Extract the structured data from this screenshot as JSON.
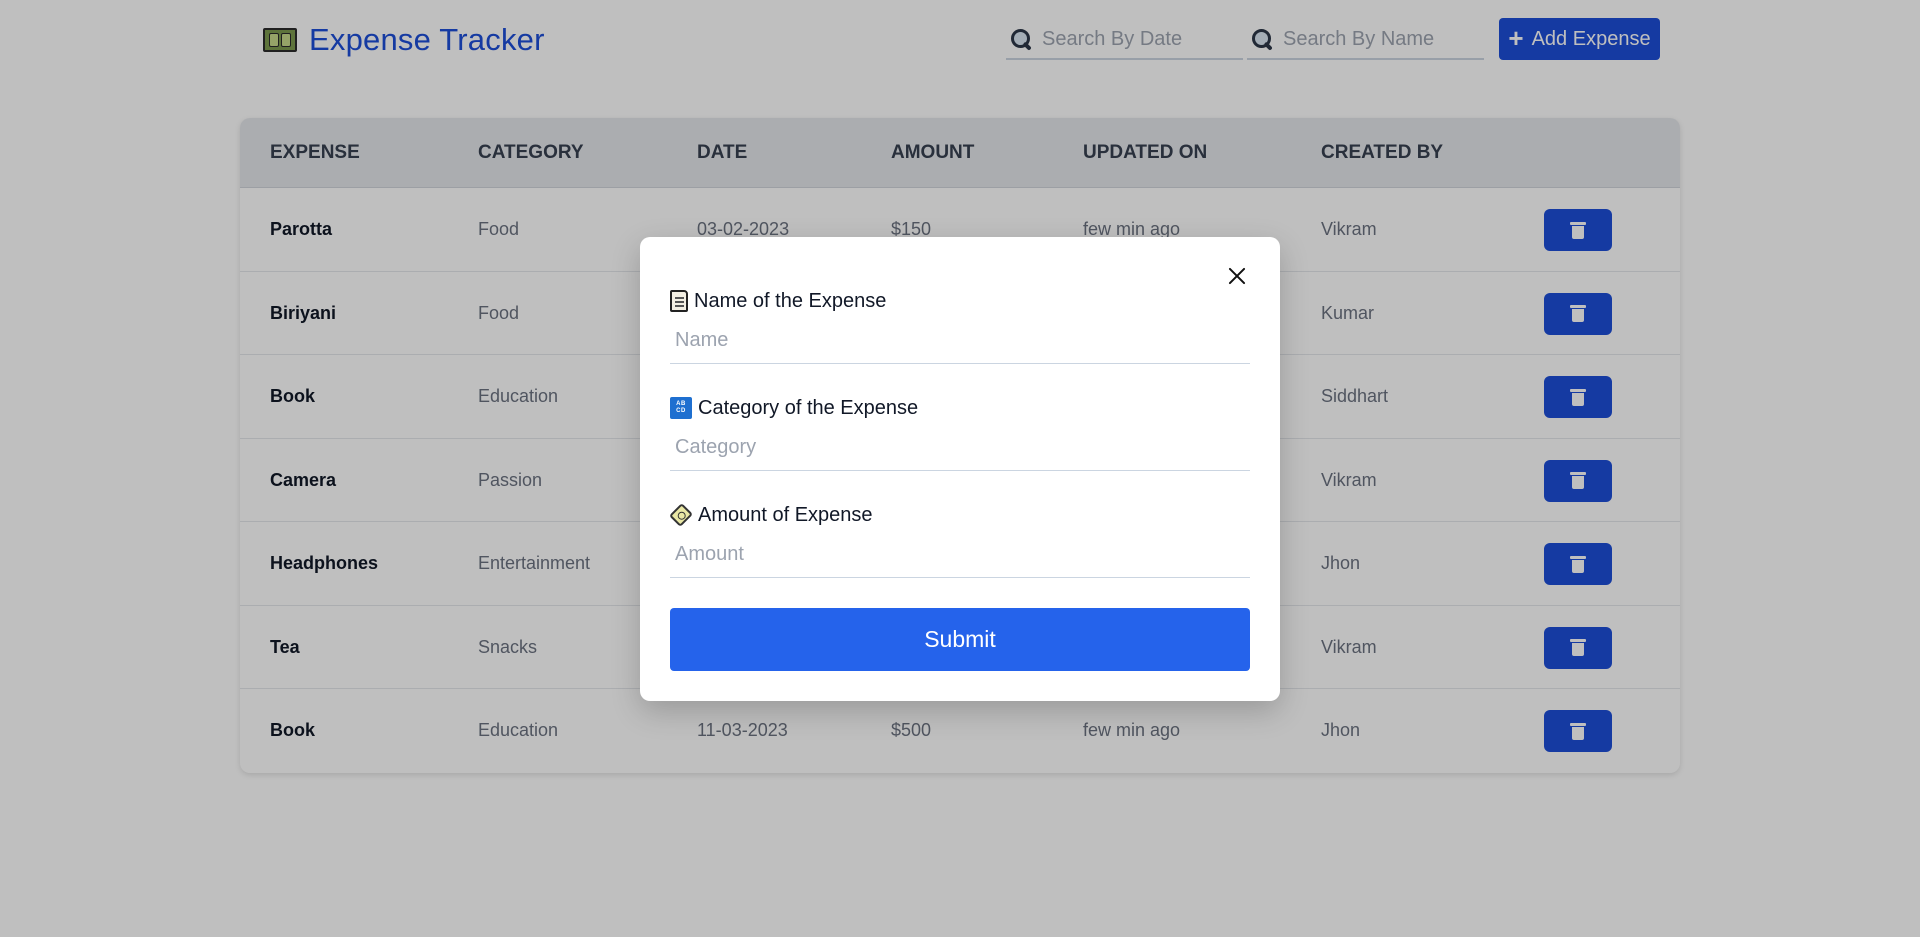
{
  "app": {
    "title": "Expense Tracker",
    "logo_icon": "money-bag-icon"
  },
  "header": {
    "search_date": {
      "placeholder": "Search By Date",
      "value": ""
    },
    "search_name": {
      "placeholder": "Search By Name",
      "value": ""
    },
    "add_button": {
      "label": "Add Expense",
      "icon": "plus-icon"
    }
  },
  "table": {
    "columns": [
      "EXPENSE",
      "CATEGORY",
      "DATE",
      "AMOUNT",
      "UPDATED ON",
      "CREATED BY"
    ],
    "rows": [
      {
        "expense": "Parotta",
        "category": "Food",
        "date": "03-02-2023",
        "amount": "$150",
        "updated": "few min ago",
        "created_by": "Vikram"
      },
      {
        "expense": "Biriyani",
        "category": "Food",
        "date": "",
        "amount": "",
        "updated": "",
        "created_by": "Kumar"
      },
      {
        "expense": "Book",
        "category": "Education",
        "date": "",
        "amount": "",
        "updated": "",
        "created_by": "Siddhart"
      },
      {
        "expense": "Camera",
        "category": "Passion",
        "date": "",
        "amount": "",
        "updated": "",
        "created_by": "Vikram"
      },
      {
        "expense": "Headphones",
        "category": "Entertainment",
        "date": "",
        "amount": "",
        "updated": "",
        "created_by": "Jhon"
      },
      {
        "expense": "Tea",
        "category": "Snacks",
        "date": "",
        "amount": "",
        "updated": "",
        "created_by": "Vikram"
      },
      {
        "expense": "Book",
        "category": "Education",
        "date": "11-03-2023",
        "amount": "$500",
        "updated": "few min ago",
        "created_by": "Jhon"
      }
    ],
    "delete_icon": "trash-icon"
  },
  "modal": {
    "close_icon": "close-icon",
    "fields": [
      {
        "label": "Name of the Expense",
        "placeholder": "Name",
        "value": "",
        "icon": "scroll-icon"
      },
      {
        "label": "Category of the Expense",
        "placeholder": "Category",
        "value": "",
        "icon": "abcd-icon"
      },
      {
        "label": "Amount of Expense",
        "placeholder": "Amount",
        "value": "",
        "icon": "ticket-icon"
      }
    ],
    "submit_label": "Submit"
  },
  "colors": {
    "primary": "#1d4ed8",
    "submit": "#2563eb",
    "table_header_bg": "#e5e7eb",
    "overlay": "rgba(0,0,0,0.25)"
  }
}
